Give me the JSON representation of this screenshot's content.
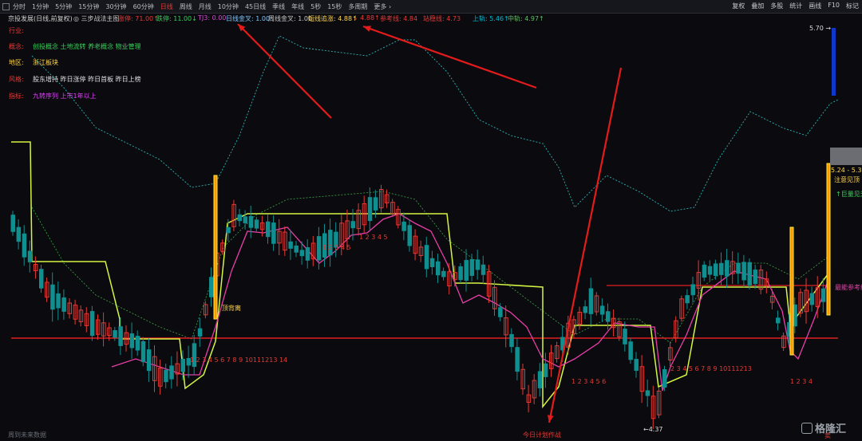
{
  "toolbar": {
    "tabs": [
      "分时",
      "1分钟",
      "5分钟",
      "15分钟",
      "30分钟",
      "60分钟",
      "日线",
      "周线",
      "月线",
      "10分钟",
      "45日线",
      "季线",
      "年线",
      "5秒",
      "15秒",
      "多周期",
      "更多 ›"
    ],
    "active_tab": "日线",
    "right_menu": [
      "复权",
      "叠加",
      "多股",
      "统计",
      "画线",
      "F10",
      "标记"
    ]
  },
  "infobar": {
    "stock": "京投发展(日线,前复权)",
    "indicator": "◎ 三步战法主图",
    "items": [
      {
        "text": "涨停: 71.00↑",
        "color": "#e53935"
      },
      {
        "text": "跌停: 11.00↓",
        "color": "#34d058"
      },
      {
        "text": "TJ3: 0.00",
        "color": "#d64bd6"
      },
      {
        "text": "日线金叉: 1.00",
        "color": "#7ec8ff"
      },
      {
        "text": "周线金叉: 1.00",
        "color": "#c8c8c8"
      },
      {
        "text": "短线追涨: 4.88↑",
        "color": "#ffd54f"
      },
      {
        "text": "↓ 4.88↑",
        "color": "#e53935"
      },
      {
        "text": "参考线: 4.84",
        "color": "#e53935"
      },
      {
        "text": "站稳线: 4.73",
        "color": "#e53935"
      },
      {
        "text": "上轨: 5.46↑",
        "color": "#00bcd4"
      },
      {
        "text": "中轨: 4.97↑",
        "color": "#66bb6a"
      }
    ]
  },
  "side_info": [
    {
      "key": "行业:",
      "value": "",
      "key_color": "#e53935",
      "value_color": "#3f51b5"
    },
    {
      "key": "概念:",
      "value": "创投概念 土地流转 养老概念 物业管理",
      "key_color": "#e53935",
      "value_color": "#34d058"
    },
    {
      "key": "地区:",
      "value": "浙江板块",
      "key_color": "#ffd54f",
      "value_color": "#ffd54f"
    },
    {
      "key": "风格:",
      "value": "股东增持 昨日涨停 昨日首板 昨日上榜",
      "key_color": "#e53935",
      "value_color": "#e0e0e0"
    },
    {
      "key": "指标:",
      "value": "九转序列 上市1年以上",
      "key_color": "#e53935",
      "value_color": "#e040fb"
    }
  ],
  "annotations": {
    "top_divergence": "顶背离",
    "bottom_price": "4.37",
    "today_plan": "今日计划作战",
    "price_range": "5.24 - 5.30",
    "watch_top": "注意见顶",
    "huge_volume": "巨量见天",
    "strong_ref": "最能参考线",
    "right_price": "5.70",
    "bottom_mark": "卖"
  },
  "bottom_counters": [
    {
      "label": "1 2 3 4 5 6 7 8 9 10111213 14"
    },
    {
      "label": "1 2 3 4 5 6"
    },
    {
      "label": "2 3 4 5 6 7 8 9 10111213"
    },
    {
      "label": "1 2 3 4"
    }
  ],
  "upper_counters": [
    {
      "label": "1 2 3 4 5"
    },
    {
      "label": "1 2 3 4 5"
    }
  ],
  "footer": "周到未来数据",
  "watermark": "格隆汇",
  "colors": {
    "up": "#e53935",
    "down": "#0f8f8f",
    "support": "#e02020",
    "upper_band": "#2bb3b3",
    "mid_band": "#3aa64a",
    "trend_line": "#d4f542",
    "pink_line": "#e83ea8",
    "arrow": "#e31b1b"
  }
}
